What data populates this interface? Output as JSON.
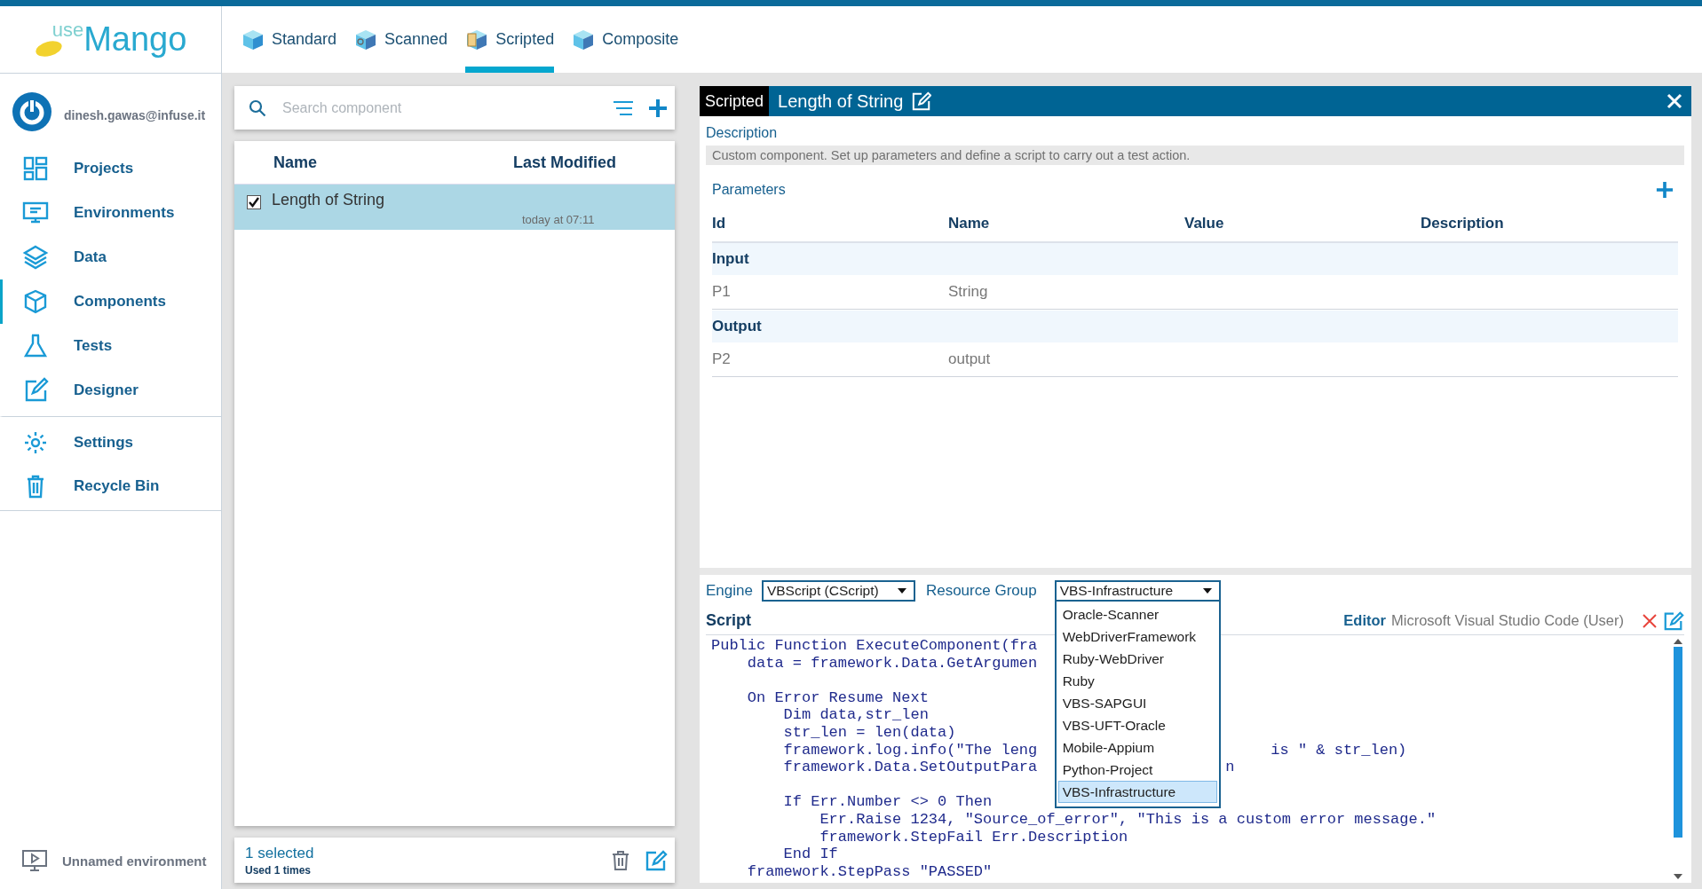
{
  "logo": {
    "prefix": "use",
    "name": "Mango"
  },
  "user": {
    "email": "dinesh.gawas@infuse.it"
  },
  "nav": [
    {
      "label": "Projects",
      "selected": false,
      "divider_before": false
    },
    {
      "label": "Environments",
      "selected": false,
      "divider_before": false
    },
    {
      "label": "Data",
      "selected": false,
      "divider_before": false
    },
    {
      "label": "Components",
      "selected": true,
      "divider_before": false
    },
    {
      "label": "Tests",
      "selected": false,
      "divider_before": false
    },
    {
      "label": "Designer",
      "selected": false,
      "divider_before": false
    },
    {
      "label": "Settings",
      "selected": false,
      "divider_before": true
    },
    {
      "label": "Recycle Bin",
      "selected": false,
      "divider_before": false
    }
  ],
  "environment": {
    "label": "Unnamed environment"
  },
  "tabs": [
    {
      "label": "Standard",
      "selected": false
    },
    {
      "label": "Scanned",
      "selected": false
    },
    {
      "label": "Scripted",
      "selected": true
    },
    {
      "label": "Composite",
      "selected": false
    }
  ],
  "search": {
    "placeholder": "Search component"
  },
  "list": {
    "columns": [
      "Name",
      "Last Modified"
    ],
    "rows": [
      {
        "name": "Length of String",
        "modified": "today at 07:11",
        "checked": true,
        "selected": true
      }
    ]
  },
  "footer": {
    "selected_count": "1 selected",
    "usage": "Used 1 times"
  },
  "detail": {
    "type_tag": "Scripted",
    "title": "Length of String",
    "description_label": "Description",
    "description": "Custom component. Set up parameters and define a script to carry out a test action.",
    "parameters_label": "Parameters",
    "param_columns": [
      "Id",
      "Name",
      "Value",
      "Description"
    ],
    "param_groups": [
      {
        "label": "Input",
        "rows": [
          {
            "id": "P1",
            "name": "String"
          }
        ]
      },
      {
        "label": "Output",
        "rows": [
          {
            "id": "P2",
            "name": "output"
          }
        ]
      }
    ]
  },
  "script": {
    "engine_label": "Engine",
    "engine": "VBScript (CScript)",
    "resource_group_label": "Resource Group",
    "resource_group": "VBS-Infrastructure",
    "resource_options": [
      {
        "label": "Oracle-Scanner",
        "selected": false
      },
      {
        "label": "WebDriverFramework",
        "selected": false
      },
      {
        "label": "Ruby-WebDriver",
        "selected": false
      },
      {
        "label": "Ruby",
        "selected": false
      },
      {
        "label": "VBS-SAPGUI",
        "selected": false
      },
      {
        "label": "VBS-UFT-Oracle",
        "selected": false
      },
      {
        "label": "Mobile-Appium",
        "selected": false
      },
      {
        "label": "Python-Project",
        "selected": false
      },
      {
        "label": "VBS-Infrastructure",
        "selected": true
      }
    ],
    "script_label": "Script",
    "editor_label": "Editor",
    "editor": "Microsoft Visual Studio Code (User)",
    "lines": [
      {
        "text": "Public Function ExecuteComponent(fra",
        "blank_before": false
      },
      {
        "text": "    data = framework.Data.GetArgumen",
        "blank_before": false
      },
      {
        "text": "    On Error Resume Next",
        "blank_before": true
      },
      {
        "text": "        Dim data,str_len",
        "blank_before": false
      },
      {
        "text": "        str_len = len(data)",
        "blank_before": false
      },
      {
        "text": "        framework.log.info(\"The leng",
        "after": "     is \" & str_len)",
        "blank_before": false
      },
      {
        "text": "        framework.Data.SetOutputPara",
        "after": "n",
        "blank_before": false
      },
      {
        "text": "        If Err.Number <> 0 Then",
        "blank_before": true
      },
      {
        "text": "            Err.Raise 1234, \"Source_of_error\", \"This is a custom error message.\"",
        "blank_before": false
      },
      {
        "text": "            framework.StepFail Err.Description",
        "blank_before": false
      },
      {
        "text": "        End If",
        "blank_before": false
      },
      {
        "text": "    framework.StepPass \"PASSED\"",
        "blank_before": false
      }
    ]
  }
}
